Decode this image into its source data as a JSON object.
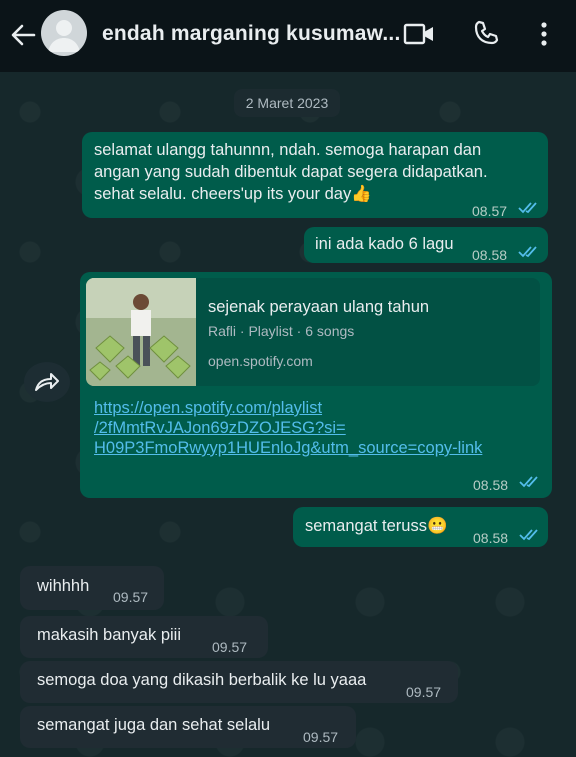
{
  "header": {
    "contact_name": "endah marganing kusumaw..."
  },
  "date_chip": "2 Maret 2023",
  "messages": [
    {
      "text_lines": [
        "selamat ulangg tahunnn, ndah. semoga harapan dan",
        "angan yang sudah dibentuk dapat segera didapatkan.",
        "sehat selalu. cheers'up its your day👍"
      ],
      "time": "08.57"
    },
    {
      "text": "ini ada kado 6 lagu",
      "time": "08.58"
    },
    {
      "card_title": "sejenak perayaan ulang tahun",
      "card_sub": "Rafli · Playlist · 6 songs",
      "card_domain": "open.spotify.com",
      "url_lines": [
        "https://open.spotify.com/playlist",
        "/2fMmtRvJAJon69zDZOJESG?si=",
        "H09P3FmoRwyyp1HUEnloJg&utm_source=copy-link"
      ],
      "time": "08.58"
    },
    {
      "text": "semangat teruss😬",
      "time": "08.58"
    },
    {
      "text": "wihhhh",
      "time": "09.57"
    },
    {
      "text": "makasih banyak piii",
      "time": "09.57"
    },
    {
      "text": "semoga doa yang dikasih berbalik ke lu yaaa",
      "time": "09.57"
    },
    {
      "text": "semangat juga dan sehat selalu",
      "time": "09.57"
    }
  ],
  "colors": {
    "outgoing": "#005c4b",
    "incoming": "#202c33",
    "link": "#53bdeb",
    "read_tick": "#53bdeb"
  }
}
